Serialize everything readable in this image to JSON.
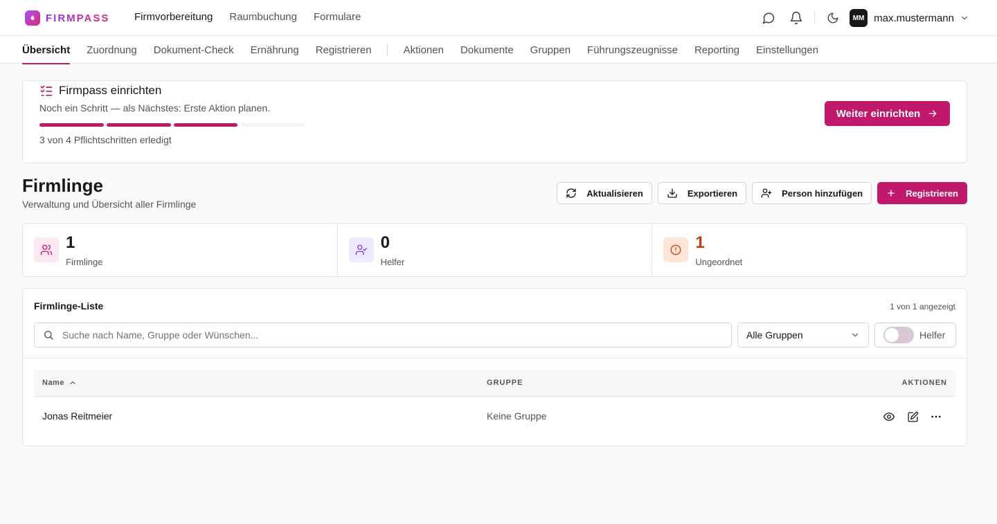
{
  "app": {
    "name": "FIRMPASS"
  },
  "mainnav": {
    "items": [
      "Firmvorbereitung",
      "Raumbuchung",
      "Formulare"
    ]
  },
  "user": {
    "initials": "MM",
    "name": "max.mustermann"
  },
  "subnav": {
    "items": [
      "Übersicht",
      "Zuordnung",
      "Dokument-Check",
      "Ernährung",
      "Registrieren",
      "Aktionen",
      "Dokumente",
      "Gruppen",
      "Führungszeugnisse",
      "Reporting",
      "Einstellungen"
    ],
    "active": "Übersicht"
  },
  "setup": {
    "title": "Firmpass einrichten",
    "subtitle": "Noch ein Schritt — als Nächstes: Erste Aktion planen.",
    "progress": {
      "done": 3,
      "total": 4
    },
    "count_text": "3 von 4 Pflichtschritten erledigt",
    "button": "Weiter einrichten"
  },
  "page": {
    "title": "Firmlinge",
    "subtitle": "Verwaltung und Übersicht aller Firmlinge",
    "actions": {
      "refresh": "Aktualisieren",
      "export": "Exportieren",
      "add_person": "Person hinzufügen",
      "register": "Registrieren"
    }
  },
  "stats": [
    {
      "value": "1",
      "label": "Firmlinge",
      "icon": "users-icon",
      "bg": "#fce7f3",
      "fg": "#c0186a",
      "valueColor": "#18181b"
    },
    {
      "value": "0",
      "label": "Helfer",
      "icon": "user-check-icon",
      "bg": "#ede9fe",
      "fg": "#7c3aed",
      "valueColor": "#18181b"
    },
    {
      "value": "1",
      "label": "Ungeordnet",
      "icon": "alert-circle-icon",
      "bg": "#fce4d6",
      "fg": "#c2410c",
      "valueColor": "#c2410c"
    }
  ],
  "list": {
    "title": "Firmlinge-Liste",
    "count": "1 von 1 angezeigt",
    "search_placeholder": "Suche nach Name, Gruppe oder Wünschen...",
    "group_select": "Alle Gruppen",
    "helper_toggle": "Helfer",
    "columns": {
      "name": "Name",
      "group": "GRUPPE",
      "actions": "AKTIONEN"
    },
    "rows": [
      {
        "name": "Jonas Reitmeier",
        "group": "Keine Gruppe"
      }
    ]
  },
  "colors": {
    "accent": "#c0186a"
  }
}
